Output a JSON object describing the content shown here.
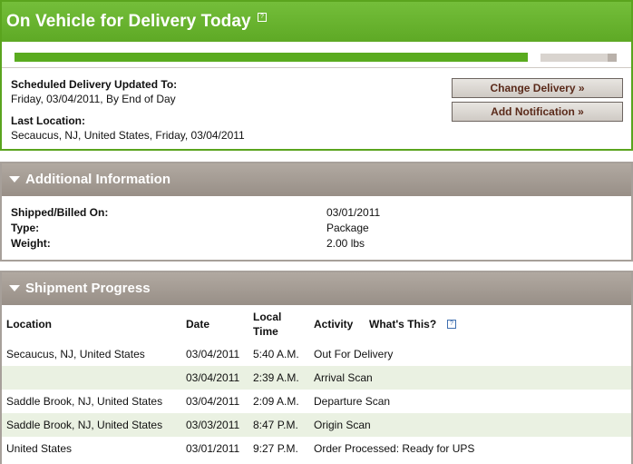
{
  "status": {
    "title": "On Vehicle for Delivery Today",
    "help_glyph": "?",
    "progress_fraction": 0.85,
    "scheduled_label": "Scheduled Delivery Updated To:",
    "scheduled_value": "Friday, 03/04/2011, By End of Day",
    "last_location_label": "Last Location:",
    "last_location_value": "Secaucus, NJ, United States, Friday, 03/04/2011",
    "change_delivery_label": "Change Delivery »",
    "add_notification_label": "Add Notification »"
  },
  "additional": {
    "title": "Additional Information",
    "rows": [
      {
        "label": "Shipped/Billed On:",
        "value": "03/01/2011"
      },
      {
        "label": "Type:",
        "value": "Package"
      },
      {
        "label": "Weight:",
        "value": "2.00 lbs"
      }
    ]
  },
  "progress": {
    "title": "Shipment Progress",
    "headers": {
      "location": "Location",
      "date": "Date",
      "local_time_1": "Local",
      "local_time_2": "Time",
      "activity": "Activity",
      "whats_this": "What's This?",
      "help_glyph": "?"
    },
    "rows": [
      {
        "location": "Secaucus, NJ, United States",
        "date": "03/04/2011",
        "time": "5:40 A.M.",
        "activity": "Out For Delivery"
      },
      {
        "location": "",
        "date": "03/04/2011",
        "time": "2:39 A.M.",
        "activity": "Arrival Scan"
      },
      {
        "location": "Saddle Brook, NJ, United States",
        "date": "03/04/2011",
        "time": "2:09 A.M.",
        "activity": "Departure Scan"
      },
      {
        "location": "Saddle Brook, NJ, United States",
        "date": "03/03/2011",
        "time": "8:47 P.M.",
        "activity": "Origin Scan"
      },
      {
        "location": "United States",
        "date": "03/01/2011",
        "time": "9:27 P.M.",
        "activity": "Order Processed: Ready for UPS"
      }
    ]
  }
}
